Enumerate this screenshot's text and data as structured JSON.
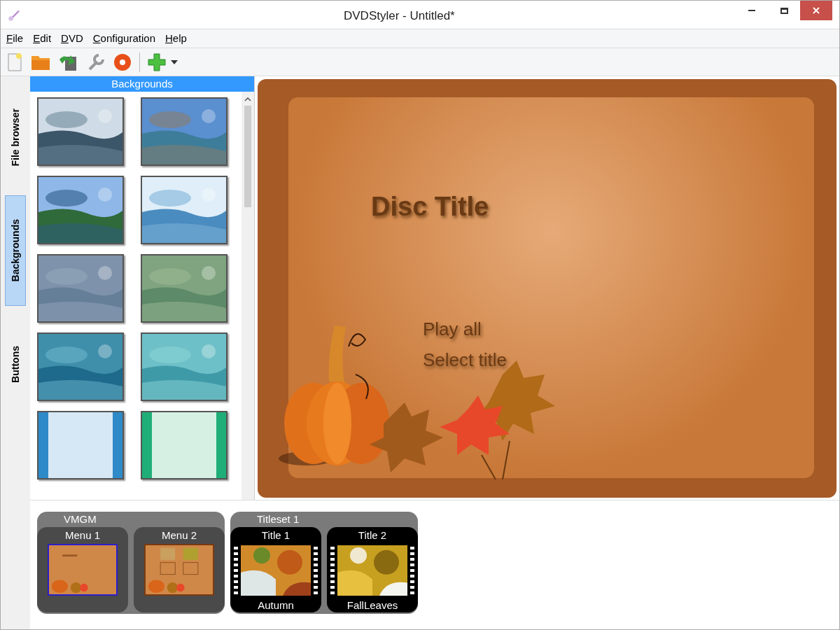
{
  "window": {
    "title": "DVDStyler - Untitled*"
  },
  "menu": [
    "File",
    "Edit",
    "DVD",
    "Configuration",
    "Help"
  ],
  "side_tabs": [
    {
      "label": "File browser",
      "selected": false
    },
    {
      "label": "Backgrounds",
      "selected": true
    },
    {
      "label": "Buttons",
      "selected": false
    }
  ],
  "panel": {
    "title": "Backgrounds"
  },
  "canvas": {
    "texts": [
      {
        "kind": "title",
        "text": "Disc Title"
      },
      {
        "kind": "button",
        "text": "Play all"
      },
      {
        "kind": "button",
        "text": "Select title"
      }
    ]
  },
  "structure": [
    {
      "label": "VMGM",
      "items": [
        {
          "kind": "menu",
          "title": "Menu 1",
          "selected": true
        },
        {
          "kind": "menu",
          "title": "Menu 2",
          "selected": false
        }
      ]
    },
    {
      "label": "Titleset 1",
      "items": [
        {
          "kind": "title",
          "title": "Title 1",
          "caption": "Autumn",
          "selected": false
        },
        {
          "kind": "title",
          "title": "Title 2",
          "caption": "FallLeaves",
          "selected": false
        }
      ]
    }
  ]
}
